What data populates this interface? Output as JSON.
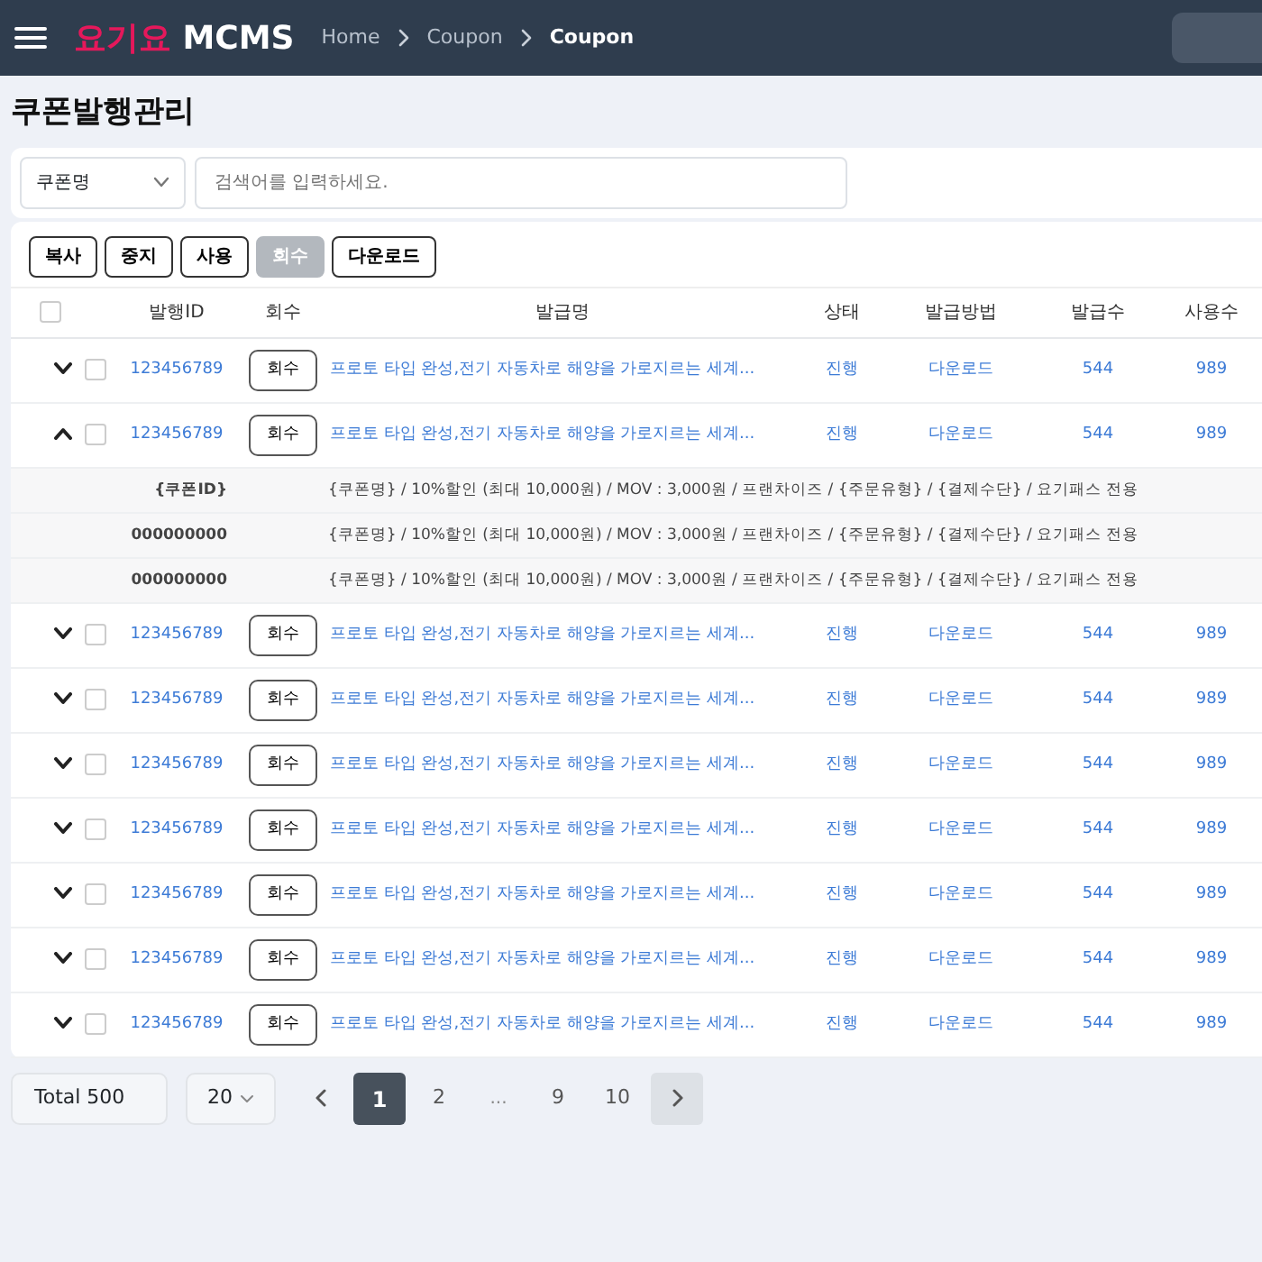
{
  "header": {
    "logo_brand": "요기요",
    "logo_product": "MCMS",
    "breadcrumbs": [
      {
        "label": "Home",
        "current": false
      },
      {
        "label": "Coupon",
        "current": false
      },
      {
        "label": "Coupon",
        "current": true
      }
    ]
  },
  "page_title": "쿠폰발행관리",
  "search": {
    "select_value": "쿠폰명",
    "placeholder": "검색어를 입력하세요."
  },
  "toolbar": [
    {
      "label": "복사",
      "disabled": false
    },
    {
      "label": "중지",
      "disabled": false
    },
    {
      "label": "사용",
      "disabled": false
    },
    {
      "label": "회수",
      "disabled": true
    },
    {
      "label": "다운로드",
      "disabled": false
    }
  ],
  "table": {
    "select_all_checked": false,
    "columns": [
      "발행ID",
      "회수",
      "발급명",
      "상태",
      "발급방법",
      "발급수",
      "사용수"
    ],
    "rows": [
      {
        "expanded": false,
        "checked": false,
        "id": "123456789",
        "recall": "회수",
        "name": "프로토 타입 완성,전기 자동차로 해양을 가로지르는 세계...",
        "status": "진행",
        "method": "다운로드",
        "issued": "544",
        "used": "989"
      },
      {
        "expanded": true,
        "checked": false,
        "id": "123456789",
        "recall": "회수",
        "name": "프로토 타입 완성,전기 자동차로 해양을 가로지르는 세계...",
        "status": "진행",
        "method": "다운로드",
        "issued": "544",
        "used": "989",
        "details": [
          {
            "coupon_id": "{쿠폰ID}",
            "info": "{쿠폰명} / 10%할인 (최대 10,000원) / MOV : 3,000원 / 프랜차이즈 / {주문유형} / {결제수단} / 요기패스 전용"
          },
          {
            "coupon_id": "000000000",
            "info": "{쿠폰명} / 10%할인 (최대 10,000원) / MOV : 3,000원 / 프랜차이즈 / {주문유형} / {결제수단} / 요기패스 전용"
          },
          {
            "coupon_id": "000000000",
            "info": "{쿠폰명} / 10%할인 (최대 10,000원) / MOV : 3,000원 / 프랜차이즈 / {주문유형} / {결제수단} / 요기패스 전용"
          }
        ]
      },
      {
        "expanded": false,
        "checked": false,
        "id": "123456789",
        "recall": "회수",
        "name": "프로토 타입 완성,전기 자동차로 해양을 가로지르는 세계...",
        "status": "진행",
        "method": "다운로드",
        "issued": "544",
        "used": "989"
      },
      {
        "expanded": false,
        "checked": false,
        "id": "123456789",
        "recall": "회수",
        "name": "프로토 타입 완성,전기 자동차로 해양을 가로지르는 세계...",
        "status": "진행",
        "method": "다운로드",
        "issued": "544",
        "used": "989"
      },
      {
        "expanded": false,
        "checked": false,
        "id": "123456789",
        "recall": "회수",
        "name": "프로토 타입 완성,전기 자동차로 해양을 가로지르는 세계...",
        "status": "진행",
        "method": "다운로드",
        "issued": "544",
        "used": "989"
      },
      {
        "expanded": false,
        "checked": false,
        "id": "123456789",
        "recall": "회수",
        "name": "프로토 타입 완성,전기 자동차로 해양을 가로지르는 세계...",
        "status": "진행",
        "method": "다운로드",
        "issued": "544",
        "used": "989"
      },
      {
        "expanded": false,
        "checked": false,
        "id": "123456789",
        "recall": "회수",
        "name": "프로토 타입 완성,전기 자동차로 해양을 가로지르는 세계...",
        "status": "진행",
        "method": "다운로드",
        "issued": "544",
        "used": "989"
      },
      {
        "expanded": false,
        "checked": false,
        "id": "123456789",
        "recall": "회수",
        "name": "프로토 타입 완성,전기 자동차로 해양을 가로지르는 세계...",
        "status": "진행",
        "method": "다운로드",
        "issued": "544",
        "used": "989"
      },
      {
        "expanded": false,
        "checked": false,
        "id": "123456789",
        "recall": "회수",
        "name": "프로토 타입 완성,전기 자동차로 해양을 가로지르는 세계...",
        "status": "진행",
        "method": "다운로드",
        "issued": "544",
        "used": "989"
      }
    ]
  },
  "pagination": {
    "total": "Total 500",
    "page_size": "20",
    "prev_highlighted": false,
    "next_highlighted": true,
    "pages": [
      {
        "label": "1",
        "kind": "page",
        "selected": true
      },
      {
        "label": "2",
        "kind": "page",
        "selected": false
      },
      {
        "label": "...",
        "kind": "ellipsis",
        "selected": false
      },
      {
        "label": "9",
        "kind": "page",
        "selected": false
      },
      {
        "label": "10",
        "kind": "page",
        "selected": false
      }
    ]
  }
}
